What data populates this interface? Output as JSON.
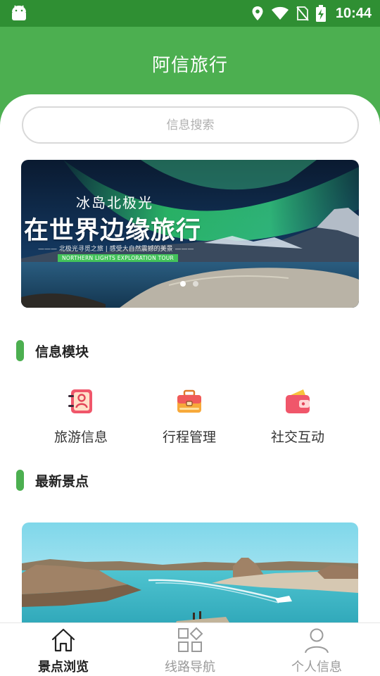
{
  "status_bar": {
    "time": "10:44",
    "icons": [
      "android-icon",
      "location-icon",
      "wifi-icon",
      "no-sim-icon",
      "battery-charging-icon"
    ]
  },
  "app_bar": {
    "title": "阿信旅行"
  },
  "search": {
    "placeholder": "信息搜索",
    "value": ""
  },
  "banner": {
    "small_title": "冰岛北极光",
    "big_title": "在世界边缘旅行",
    "subtitle": "——— 北极光寻觅之旅 | 感受大自然震撼的美景 ———",
    "tag": "NORTHERN LIGHTS EXPLORATION TOUR",
    "slides": 2,
    "active_slide": 1
  },
  "info_section": {
    "title": "信息模块",
    "items": [
      {
        "label": "旅游信息",
        "icon": "contact-book-icon"
      },
      {
        "label": "行程管理",
        "icon": "briefcase-icon"
      },
      {
        "label": "社交互动",
        "icon": "wallet-icon"
      }
    ]
  },
  "latest_section": {
    "title": "最新景点"
  },
  "tab_bar": {
    "items": [
      {
        "label": "景点浏览",
        "icon": "home-icon",
        "active": true
      },
      {
        "label": "线路导航",
        "icon": "grid-icon",
        "active": false
      },
      {
        "label": "个人信息",
        "icon": "person-icon",
        "active": false
      }
    ]
  },
  "colors": {
    "status_bar": "#2f8f33",
    "primary": "#4caf50",
    "tab_inactive": "#9a9a9a",
    "tab_active": "#222222"
  }
}
